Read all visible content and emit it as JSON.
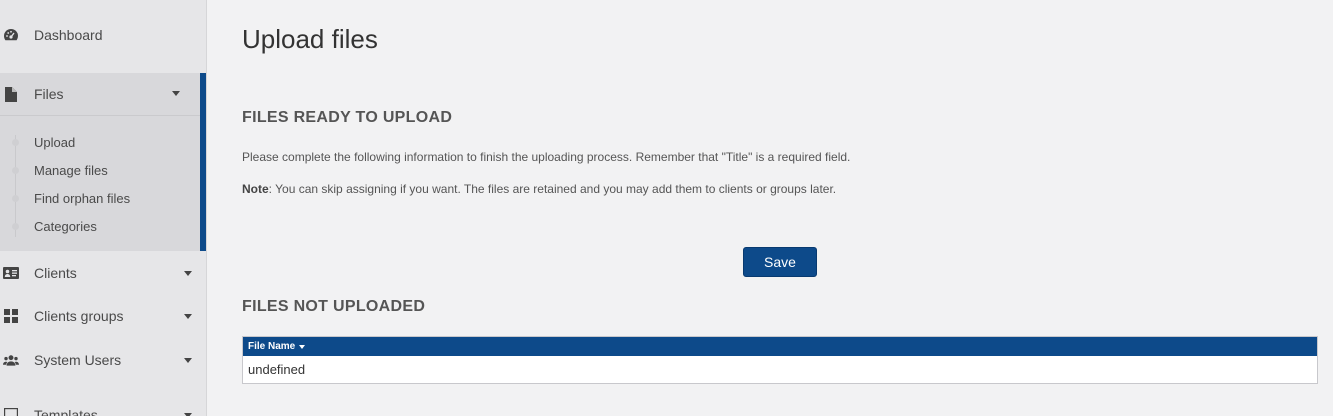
{
  "sidebar": {
    "dashboard": {
      "label": "Dashboard",
      "icon": "dashboard-icon"
    },
    "files": {
      "label": "Files",
      "icon": "file-icon",
      "submenu": [
        "Upload",
        "Manage files",
        "Find orphan files",
        "Categories"
      ]
    },
    "clients": {
      "label": "Clients",
      "icon": "id-card-icon"
    },
    "clients_groups": {
      "label": "Clients groups",
      "icon": "grid-icon"
    },
    "system_users": {
      "label": "System Users",
      "icon": "users-icon"
    },
    "templates": {
      "label": "Templates",
      "icon": "template-icon"
    }
  },
  "main": {
    "title": "Upload files",
    "ready": {
      "heading": "FILES READY TO UPLOAD",
      "instructions": "Please complete the following information to finish the uploading process. Remember that \"Title\" is a required field.",
      "note_label": "Note",
      "note_text": ": You can skip assigning if you want. The files are retained and you may add them to clients or groups later."
    },
    "save_label": "Save",
    "not_uploaded": {
      "heading": "FILES NOT UPLOADED",
      "column_header": "File Name",
      "rows": [
        "undefined"
      ]
    }
  },
  "colors": {
    "accent": "#0d4a8a",
    "sidebar_bg": "#e6e6e8",
    "page_bg": "#f2f2f3"
  }
}
